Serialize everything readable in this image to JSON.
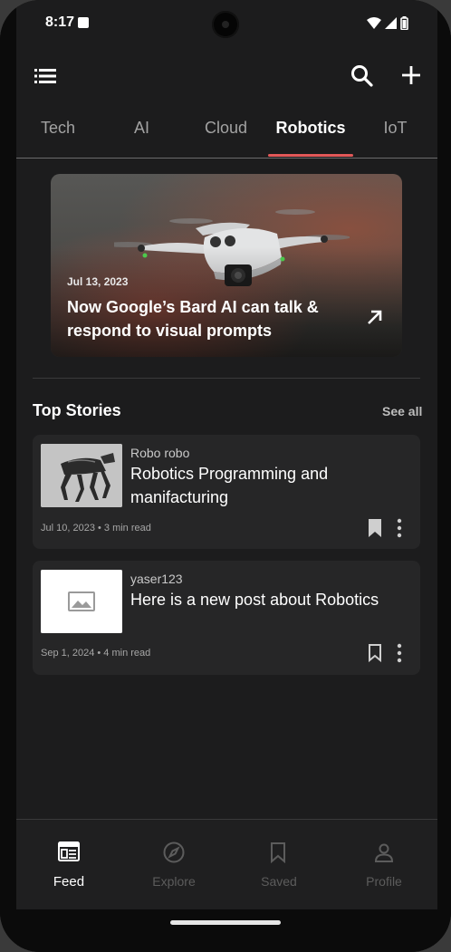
{
  "status": {
    "time": "8:17"
  },
  "tabs": [
    {
      "label": "Tech"
    },
    {
      "label": "AI"
    },
    {
      "label": "Cloud"
    },
    {
      "label": "Robotics"
    },
    {
      "label": "IoT"
    }
  ],
  "active_tab": "Robotics",
  "hero": {
    "date": "Jul 13, 2023",
    "title": "Now Google’s Bard AI can talk & respond to visual prompts"
  },
  "top_stories": {
    "title": "Top Stories",
    "see_all": "See all",
    "items": [
      {
        "author": "Robo robo",
        "title": "Robotics Programming and manifacturing",
        "meta": "Jul 10, 2023 • 3 min read",
        "bookmarked": true,
        "thumbnail_icon": "robot-dog-image"
      },
      {
        "author": "yaser123",
        "title": "Here is a new post about Robotics",
        "meta": "Sep 1, 2024 • 4 min read",
        "bookmarked": false,
        "thumbnail_icon": "image-placeholder-icon"
      }
    ]
  },
  "bottom_nav": [
    {
      "label": "Feed",
      "icon": "feed-icon",
      "active": true
    },
    {
      "label": "Explore",
      "icon": "compass-icon",
      "active": false
    },
    {
      "label": "Saved",
      "icon": "bookmark-icon",
      "active": false
    },
    {
      "label": "Profile",
      "icon": "person-icon",
      "active": false
    }
  ],
  "colors": {
    "accent": "#e25858",
    "background": "#1c1c1d",
    "card": "#262627"
  }
}
